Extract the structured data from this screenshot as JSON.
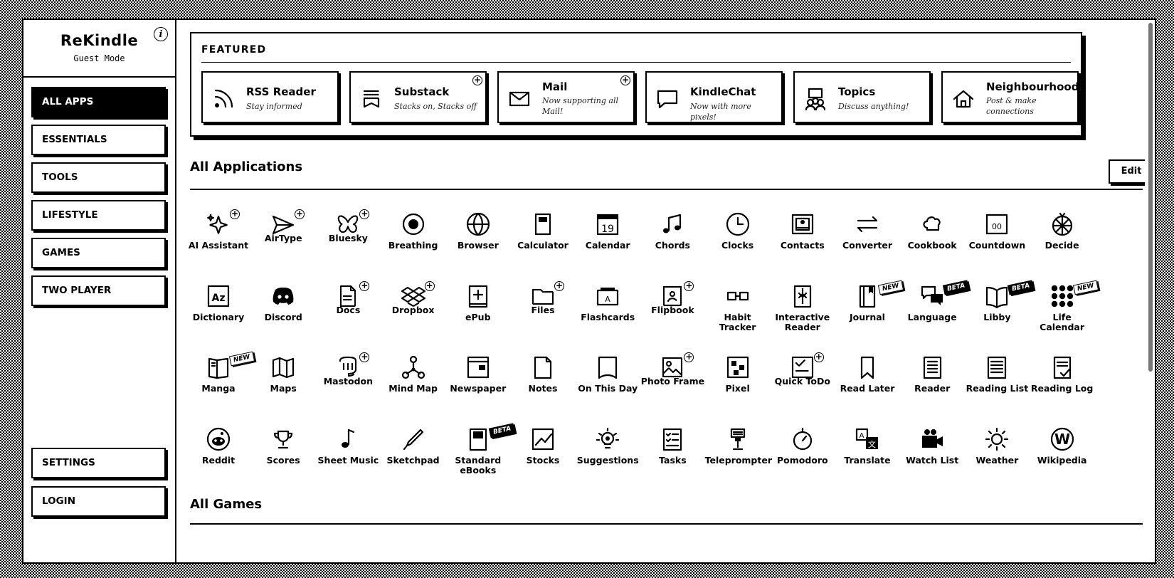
{
  "brand": {
    "title": "ReKindle",
    "subtitle": "Guest Mode",
    "info": "i"
  },
  "nav": {
    "all_apps": "ALL APPS",
    "essentials": "ESSENTIALS",
    "tools": "TOOLS",
    "lifestyle": "LIFESTYLE",
    "games": "GAMES",
    "two_player": "TWO PLAYER",
    "settings": "SETTINGS",
    "login": "LOGIN"
  },
  "featured": {
    "title": "FEATURED",
    "cards": [
      {
        "name": "RSS Reader",
        "desc": "Stay informed",
        "icon": "rss-icon"
      },
      {
        "name": "Substack",
        "desc": "Stacks on, Stacks off",
        "icon": "substack-icon"
      },
      {
        "name": "Mail",
        "desc": "Now supporting all Mail!",
        "icon": "mail-icon"
      },
      {
        "name": "KindleChat",
        "desc": "Now with more pixels!",
        "icon": "chat-icon"
      },
      {
        "name": "Topics",
        "desc": "Discuss anything!",
        "icon": "people-icon"
      },
      {
        "name": "Neighbourhood",
        "desc": "Post & make connections",
        "icon": "house-icon"
      }
    ]
  },
  "sections": {
    "all_apps": "All Applications",
    "all_games": "All Games",
    "edit": "Edit"
  },
  "badges": {
    "plus": "+",
    "new": "NEW",
    "beta": "BETA"
  },
  "apps": [
    {
      "label": "AI Assistant",
      "icon": "sparkle-icon"
    },
    {
      "label": "AirType",
      "icon": "paper-plane-icon"
    },
    {
      "label": "Bluesky",
      "icon": "butterfly-icon"
    },
    {
      "label": "Breathing",
      "icon": "target-circle-icon"
    },
    {
      "label": "Browser",
      "icon": "globe-icon"
    },
    {
      "label": "Calculator",
      "icon": "calculator-icon"
    },
    {
      "label": "Calendar",
      "icon": "calendar-icon",
      "glyph": "19"
    },
    {
      "label": "Chords",
      "icon": "music-note-icon"
    },
    {
      "label": "Clocks",
      "icon": "clock-icon"
    },
    {
      "label": "Contacts",
      "icon": "contacts-icon"
    },
    {
      "label": "Converter",
      "icon": "swap-arrows-icon"
    },
    {
      "label": "Cookbook",
      "icon": "chef-hat-icon"
    },
    {
      "label": "Countdown",
      "icon": "countdown-icon",
      "glyph": "00"
    },
    {
      "label": "Decide",
      "icon": "wheel-icon"
    },
    {
      "label": "Dictionary",
      "icon": "dictionary-icon",
      "glyph": "Az"
    },
    {
      "label": "Discord",
      "icon": "discord-icon"
    },
    {
      "label": "Docs",
      "icon": "document-icon"
    },
    {
      "label": "Dropbox",
      "icon": "dropbox-icon"
    },
    {
      "label": "ePub",
      "icon": "epub-book-icon"
    },
    {
      "label": "Files",
      "icon": "folder-icon"
    },
    {
      "label": "Flashcards",
      "icon": "flashcard-icon",
      "glyph": "A"
    },
    {
      "label": "Flipbook",
      "icon": "flipbook-icon"
    },
    {
      "label": "Habit Tracker",
      "icon": "habit-icon"
    },
    {
      "label": "Interactive Reader",
      "icon": "interactive-book-icon"
    },
    {
      "label": "Journal",
      "icon": "journal-icon"
    },
    {
      "label": "Language",
      "icon": "speech-bubbles-icon"
    },
    {
      "label": "Libby",
      "icon": "open-book-icon"
    },
    {
      "label": "Life Calendar",
      "icon": "dot-grid-icon"
    },
    {
      "label": "Manga",
      "icon": "manga-book-icon"
    },
    {
      "label": "Maps",
      "icon": "map-icon"
    },
    {
      "label": "Mastodon",
      "icon": "mastodon-icon"
    },
    {
      "label": "Mind Map",
      "icon": "mind-map-icon"
    },
    {
      "label": "Newspaper",
      "icon": "newspaper-icon"
    },
    {
      "label": "Notes",
      "icon": "note-icon"
    },
    {
      "label": "On This Day",
      "icon": "bookmark-page-icon"
    },
    {
      "label": "Photo Frame",
      "icon": "photo-icon"
    },
    {
      "label": "Pixel",
      "icon": "pixel-icon"
    },
    {
      "label": "Quick ToDo",
      "icon": "todo-icon"
    },
    {
      "label": "Read Later",
      "icon": "bookmark-icon"
    },
    {
      "label": "Reader",
      "icon": "reader-book-icon"
    },
    {
      "label": "Reading List",
      "icon": "reading-list-icon"
    },
    {
      "label": "Reading Log",
      "icon": "reading-log-icon"
    },
    {
      "label": "Reddit",
      "icon": "reddit-icon"
    },
    {
      "label": "Scores",
      "icon": "trophy-icon"
    },
    {
      "label": "Sheet Music",
      "icon": "eighth-note-icon"
    },
    {
      "label": "Sketchpad",
      "icon": "pen-icon"
    },
    {
      "label": "Standard eBooks",
      "icon": "ebook-icon"
    },
    {
      "label": "Stocks",
      "icon": "chart-icon"
    },
    {
      "label": "Suggestions",
      "icon": "lightbulb-icon"
    },
    {
      "label": "Tasks",
      "icon": "checklist-icon"
    },
    {
      "label": "Teleprompter",
      "icon": "teleprompter-icon"
    },
    {
      "label": "Pomodoro",
      "icon": "timer-icon"
    },
    {
      "label": "Translate",
      "icon": "translate-icon",
      "glyph": "A文"
    },
    {
      "label": "Watch List",
      "icon": "video-camera-icon"
    },
    {
      "label": "Weather",
      "icon": "sun-icon"
    },
    {
      "label": "Wikipedia",
      "icon": "wikipedia-icon",
      "glyph": "W"
    }
  ]
}
